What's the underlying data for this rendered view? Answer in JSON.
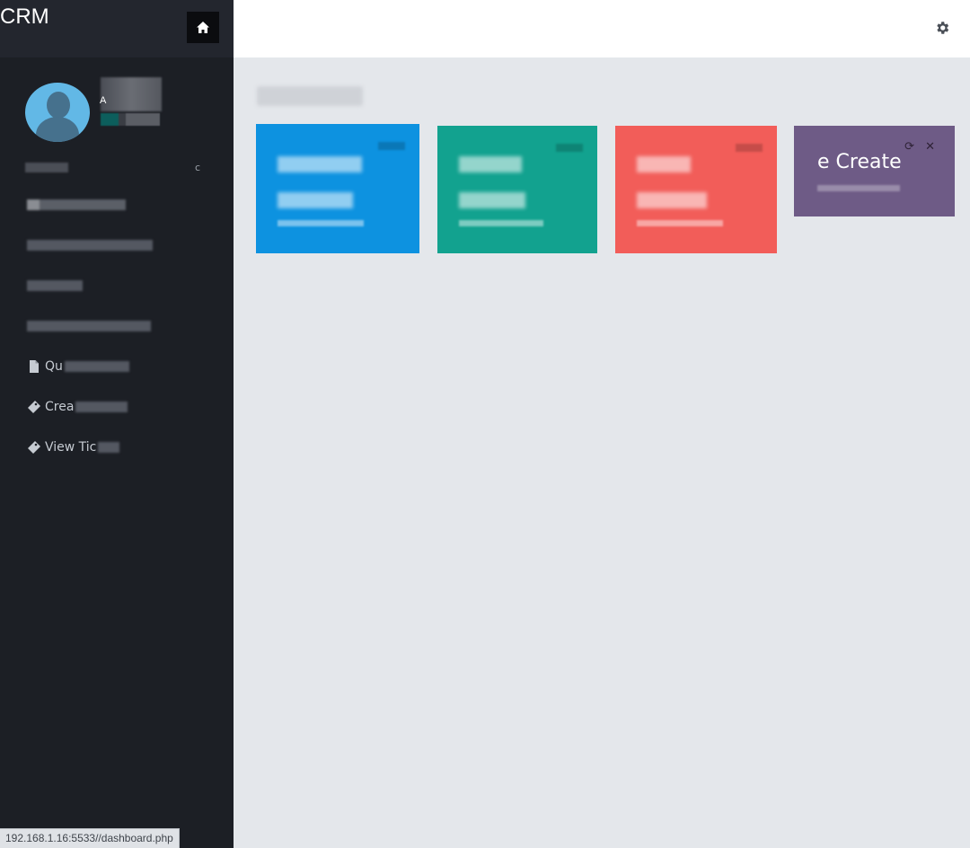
{
  "brand": {
    "title": "CRM"
  },
  "sidebar": {
    "profile": {
      "role_initial": "A"
    },
    "section_toggle": "c",
    "items": [
      {
        "label": "",
        "icon": "dashboard-icon"
      },
      {
        "label": "",
        "icon": ""
      },
      {
        "label": "",
        "icon": ""
      },
      {
        "label": "",
        "icon": ""
      },
      {
        "label": "Qu",
        "icon": "file-icon"
      },
      {
        "label": "Crea",
        "icon": "ticket-icon"
      },
      {
        "label": "View Tic",
        "icon": "ticket-icon"
      }
    ]
  },
  "topbar": {
    "settings_icon": "gear-icon",
    "home_icon": "home-icon"
  },
  "cards": [
    {
      "color": "#0d92e0",
      "title": ""
    },
    {
      "color": "#12a28f",
      "title": ""
    },
    {
      "color": "#f25d59",
      "title": ""
    },
    {
      "color": "#6e5b86",
      "title": "e Create",
      "tools": "⟳ ✕"
    }
  ],
  "status_bar": {
    "url": "192.168.1.16:5533//dashboard.php"
  }
}
